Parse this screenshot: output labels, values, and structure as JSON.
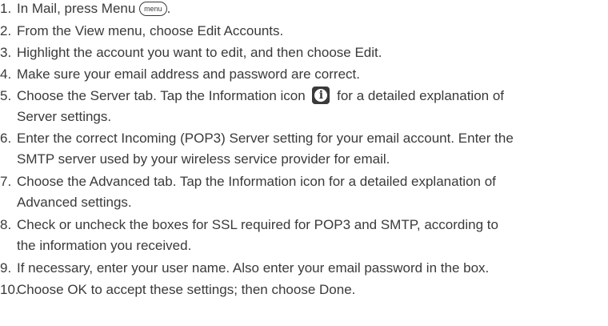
{
  "steps": [
    {
      "num": "1.",
      "before": "In Mail, press Menu ",
      "icon": "menu-key-icon",
      "icon_text": "menu",
      "after": "."
    },
    {
      "num": "2.",
      "text": "From the View menu, choose Edit Accounts."
    },
    {
      "num": "3.",
      "text": "Highlight the account you want to edit, and then choose Edit."
    },
    {
      "num": "4.",
      "text": "Make sure your email address and password are correct."
    },
    {
      "num": "5.",
      "before": "Choose the Server tab. Tap the Information icon ",
      "icon": "information-icon",
      "after": " for a detailed explanation of",
      "line2": "Server settings."
    },
    {
      "num": "6.",
      "text": "Enter the correct Incoming (POP3) Server setting for your email account. Enter the",
      "line2": "SMTP server used by your wireless service provider for email."
    },
    {
      "num": "7.",
      "text": "Choose the Advanced tab. Tap the Information icon for a detailed explanation of",
      "line2": "Advanced settings."
    },
    {
      "num": "8.",
      "text": "Check or uncheck the boxes for SSL required for POP3 and SMTP, according to",
      "line2": "the information you received."
    },
    {
      "num": "9.",
      "text": "If necessary, enter your user name. Also enter your email password in the box."
    },
    {
      "num": "10.",
      "text": "Choose OK to accept these settings; then choose Done."
    }
  ]
}
